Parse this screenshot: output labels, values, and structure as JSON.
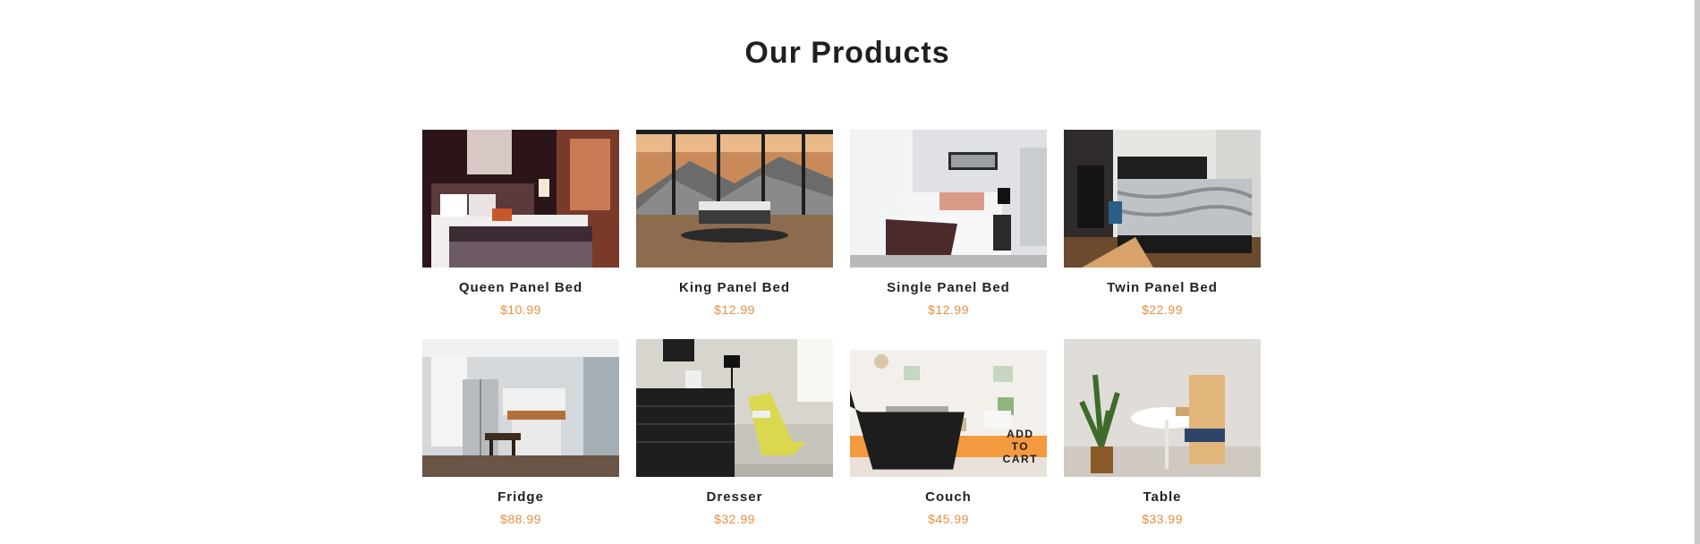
{
  "section": {
    "title": "Our Products"
  },
  "products": [
    {
      "name": "Queen Panel Bed",
      "price": "$10.99"
    },
    {
      "name": "King Panel Bed",
      "price": "$12.99"
    },
    {
      "name": "Single Panel Bed",
      "price": "$12.99"
    },
    {
      "name": "Twin Panel Bed",
      "price": "$22.99"
    },
    {
      "name": "Fridge",
      "price": "$88.99"
    },
    {
      "name": "Dresser",
      "price": "$32.99"
    },
    {
      "name": "Couch",
      "price": "$45.99"
    },
    {
      "name": "Table",
      "price": "$33.99"
    }
  ],
  "cart_button": {
    "label": "ADD TO CART",
    "icon": "shopping-cart-icon"
  },
  "colors": {
    "price": "#e98e3c",
    "cart_button": "#f39a3e",
    "title": "#1f1f1f"
  }
}
